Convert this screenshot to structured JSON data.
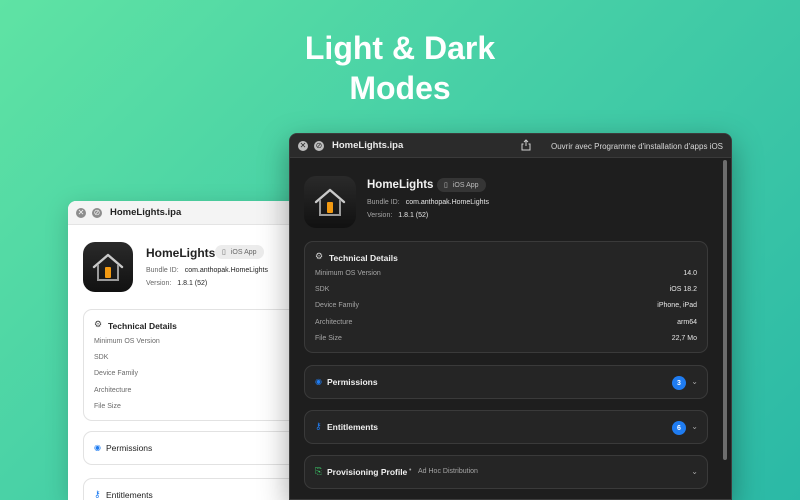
{
  "hero": {
    "line1": "Light & Dark",
    "line2": "Modes"
  },
  "light": {
    "title": "HomeLights.ipa",
    "app_name": "HomeLights",
    "badge": "iOS App",
    "bundle_label": "Bundle ID:",
    "bundle_value": "com.anthopak.HomeLights",
    "version_label": "Version:",
    "version_value": "1.8.1 (52)",
    "technical_title": "Technical Details",
    "rows": [
      "Minimum OS Version",
      "SDK",
      "Device Family",
      "Architecture",
      "File Size"
    ],
    "permissions": "Permissions",
    "entitlements": "Entitlements"
  },
  "dark": {
    "title": "HomeLights.ipa",
    "open_with": "Ouvrir avec Programme d'installation d'apps iOS",
    "app_name": "HomeLights",
    "badge": "iOS App",
    "bundle_label": "Bundle ID:",
    "bundle_value": "com.anthopak.HomeLights",
    "version_label": "Version:",
    "version_value": "1.8.1 (52)",
    "technical_title": "Technical Details",
    "rows": [
      {
        "label": "Minimum OS Version",
        "value": "14.0"
      },
      {
        "label": "SDK",
        "value": "iOS 18.2"
      },
      {
        "label": "Device Family",
        "value": "iPhone, iPad"
      },
      {
        "label": "Architecture",
        "value": "arm64"
      },
      {
        "label": "File Size",
        "value": "22,7 Mo"
      }
    ],
    "permissions": "Permissions",
    "permissions_count": "3",
    "entitlements": "Entitlements",
    "entitlements_count": "6",
    "provisioning": "Provisioning Profile",
    "provisioning_sep": "•",
    "provisioning_type": "Ad Hoc Distribution"
  },
  "colors": {
    "accent": "#1f7cf1",
    "provisioning_icon": "#3ccf6a"
  },
  "icons": [
    "close-icon",
    "info-icon",
    "house-app-icon",
    "gear-icon",
    "shield-icon",
    "key-icon",
    "doc-icon",
    "share-icon",
    "chevron-down-icon",
    "phone-icon"
  ]
}
